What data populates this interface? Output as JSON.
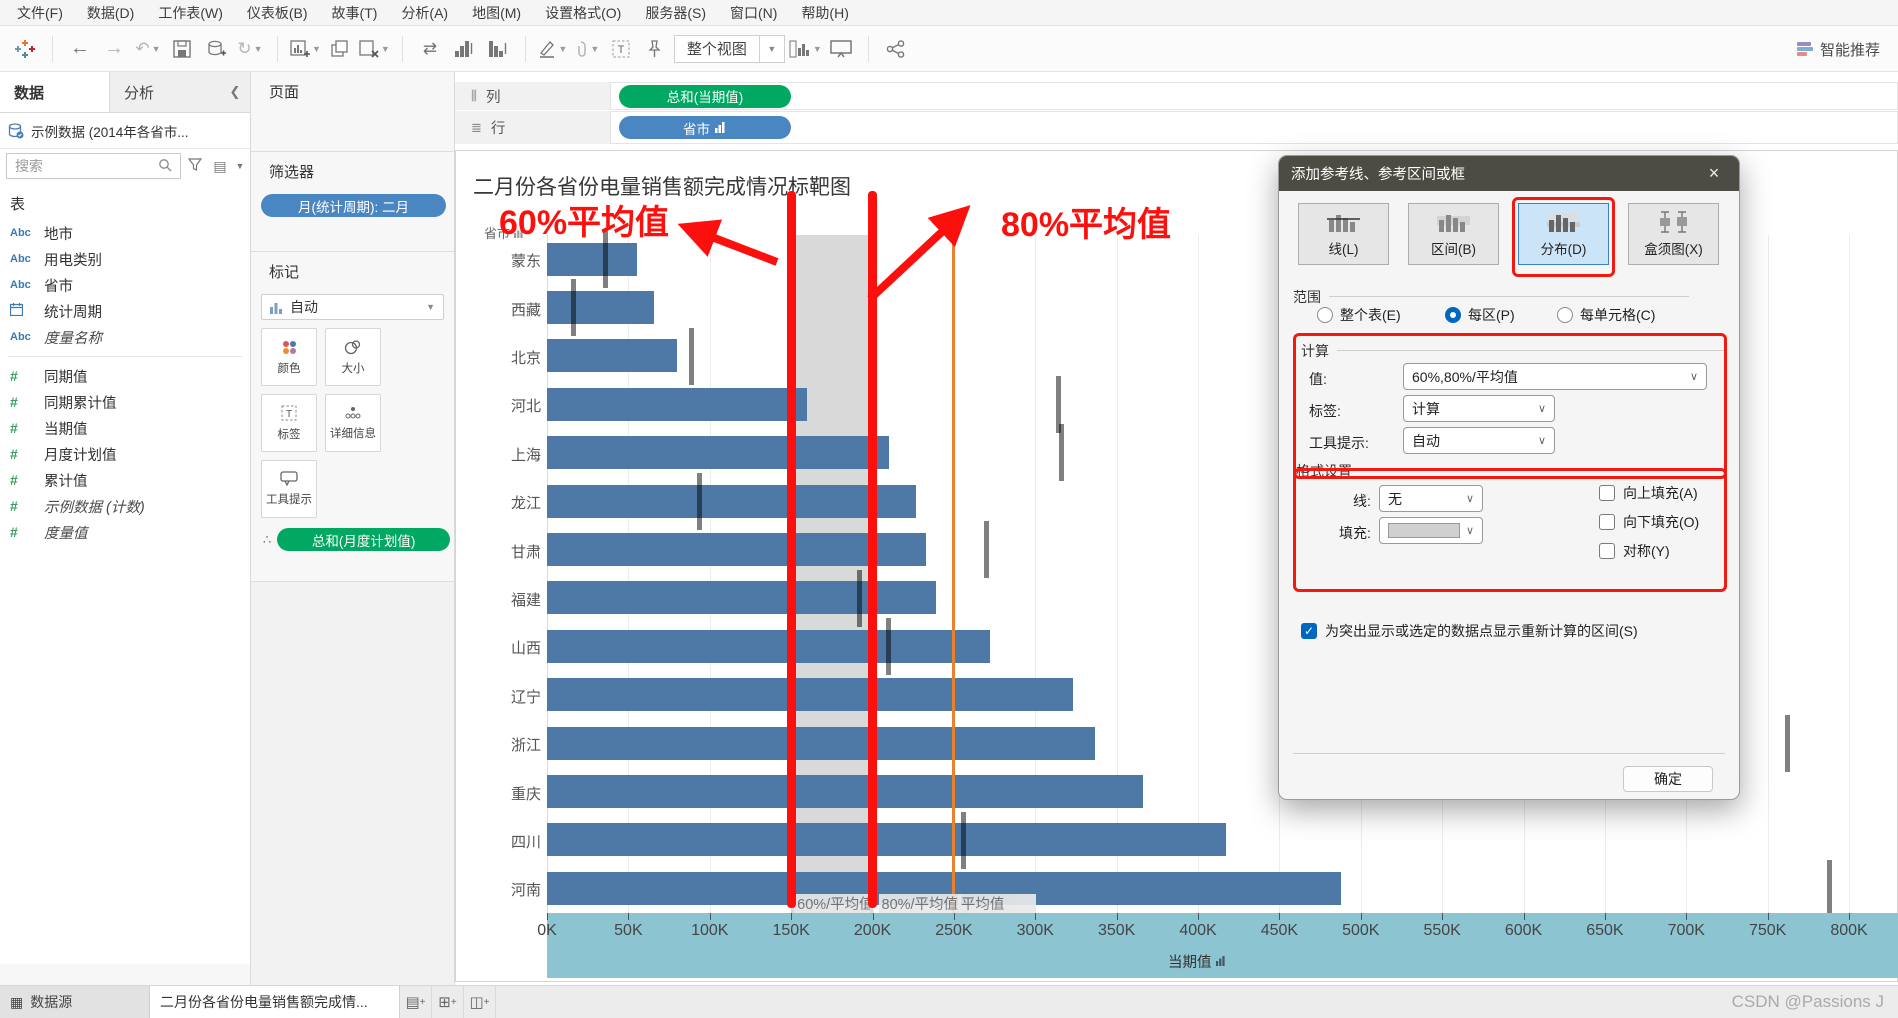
{
  "menu_bar": {
    "items": [
      "文件(F)",
      "数据(D)",
      "工作表(W)",
      "仪表板(B)",
      "故事(T)",
      "分析(A)",
      "地图(M)",
      "设置格式(O)",
      "服务器(S)",
      "窗口(N)",
      "帮助(H)"
    ]
  },
  "toolbar": {
    "view_mode": "整个视图",
    "smart_recommend": "智能推荐",
    "icons": [
      "tableau-logo",
      "back",
      "forward",
      "undo",
      "save",
      "add-data",
      "refresh",
      "new-worksheet",
      "duplicate",
      "clear-sheet",
      "swap-axes",
      "sort-ascending",
      "sort-descending",
      "highlight-pen",
      "paperclip",
      "text-object",
      "pin",
      "show-me",
      "presentation",
      "share"
    ]
  },
  "data_pane": {
    "tab_data": "数据",
    "tab_analytics": "分析",
    "datasource": "示例数据 (2014年各省市...",
    "search_placeholder": "搜索",
    "tables_label": "表",
    "fields": [
      {
        "kind": "dimension",
        "icon": "abc",
        "label": "地市"
      },
      {
        "kind": "dimension",
        "icon": "abc",
        "label": "用电类别"
      },
      {
        "kind": "dimension",
        "icon": "abc",
        "label": "省市"
      },
      {
        "kind": "dimension",
        "icon": "calendar",
        "label": "统计周期"
      },
      {
        "kind": "dimension",
        "icon": "abc",
        "label": "度量名称",
        "italic": true
      },
      {
        "kind": "measure",
        "icon": "hash",
        "label": "同期值"
      },
      {
        "kind": "measure",
        "icon": "hash",
        "label": "同期累计值"
      },
      {
        "kind": "measure",
        "icon": "hash",
        "label": "当期值"
      },
      {
        "kind": "measure",
        "icon": "hash",
        "label": "月度计划值"
      },
      {
        "kind": "measure",
        "icon": "hash",
        "label": "累计值"
      },
      {
        "kind": "measure",
        "icon": "hash",
        "label": "示例数据 (计数)",
        "italic": true
      },
      {
        "kind": "measure",
        "icon": "hash",
        "label": "度量值",
        "italic": true
      }
    ]
  },
  "cards": {
    "pages_label": "页面",
    "filters_label": "筛选器",
    "filter_pill": "月(统计周期): 二月",
    "marks_label": "标记",
    "mark_type": "自动",
    "buttons": [
      {
        "label": "颜色",
        "icon": "color"
      },
      {
        "label": "大小",
        "icon": "size"
      },
      {
        "label": "标签",
        "icon": "label"
      },
      {
        "label": "详细信息",
        "icon": "detail"
      },
      {
        "label": "工具提示",
        "icon": "tooltip"
      }
    ],
    "detail_pill": "总和(月度计划值)"
  },
  "shelves": {
    "columns_label": "列",
    "columns_pill": "总和(当期值)",
    "rows_label": "行",
    "rows_pill": "省市"
  },
  "chart_data": {
    "type": "bar",
    "orientation": "horizontal",
    "title": "二月份各省份电量销售额完成情况标靶图",
    "row_field": "省市",
    "categories": [
      "蒙东",
      "西藏",
      "北京",
      "河北",
      "上海",
      "龙江",
      "甘肃",
      "福建",
      "山西",
      "辽宁",
      "浙江",
      "重庆",
      "四川",
      "河南"
    ],
    "series": [
      {
        "name": "当期值 (条形)",
        "values": [
          55000,
          66000,
          80000,
          160000,
          210000,
          227000,
          233000,
          239000,
          272000,
          323000,
          337000,
          366000,
          417000,
          488000
        ]
      },
      {
        "name": "月度计划值 (参考线刻度)",
        "values": [
          36000,
          16000,
          89000,
          314000,
          316000,
          94000,
          270000,
          192000,
          210000,
          null,
          762000,
          null,
          256000,
          788000
        ]
      }
    ],
    "xlabel": "当期值",
    "xlim": [
      0,
      800000
    ],
    "x_tick_step": 50000,
    "x_tick_labels": [
      "0K",
      "50K",
      "100K",
      "150K",
      "200K",
      "250K",
      "300K",
      "350K",
      "400K",
      "450K",
      "500K",
      "550K",
      "600K",
      "650K",
      "700K",
      "750K",
      "800K"
    ],
    "reference_band": {
      "from": 150000,
      "to": 200000,
      "labels": [
        "60%/平均值",
        "80%/平均值"
      ]
    },
    "reference_line": {
      "value": 250000,
      "label": "平均值"
    },
    "grid": true,
    "legend": "none"
  },
  "annotations": {
    "left_label": "60%平均值",
    "right_label": "80%平均值",
    "line_values": [
      150000,
      200000
    ],
    "color": "#fb100d"
  },
  "colors": {
    "bar": "#4e79a7",
    "band": "#d6d6d6",
    "average_line": "#e8822c",
    "target_tick": "#808080",
    "pill_green": "#00a862",
    "pill_blue": "#4a87c2",
    "axis_highlight": "#8cc4d2"
  },
  "dialog": {
    "title": "添加参考线、参考区间或框",
    "types": [
      {
        "label": "线(L)",
        "selected": false
      },
      {
        "label": "区间(B)",
        "selected": false
      },
      {
        "label": "分布(D)",
        "selected": true
      },
      {
        "label": "盒须图(X)",
        "selected": false
      }
    ],
    "scope_label": "范围",
    "scope_options": [
      {
        "label": "整个表(E)",
        "selected": false
      },
      {
        "label": "每区(P)",
        "selected": true
      },
      {
        "label": "每单元格(C)",
        "selected": false
      }
    ],
    "computation_label": "计算",
    "value_label": "值:",
    "value": "60%,80%/平均值",
    "tag_label": "标签:",
    "tag": "计算",
    "tooltip_label": "工具提示:",
    "tooltip": "自动",
    "formatting_label": "格式设置",
    "line_label": "线:",
    "line_value": "无",
    "fill_label": "填充:",
    "checkboxes": [
      {
        "label": "向上填充(A)",
        "checked": false
      },
      {
        "label": "向下填充(O)",
        "checked": false
      },
      {
        "label": "对称(Y)",
        "checked": false
      }
    ],
    "recalc_label": "为突出显示或选定的数据点显示重新计算的区间(S)",
    "recalc_checked": true,
    "ok_label": "确定"
  },
  "status_bar": {
    "datasource_tab": "数据源",
    "sheet_tab": "二月份各省份电量销售额完成情...",
    "watermark": "CSDN @Passions J"
  }
}
